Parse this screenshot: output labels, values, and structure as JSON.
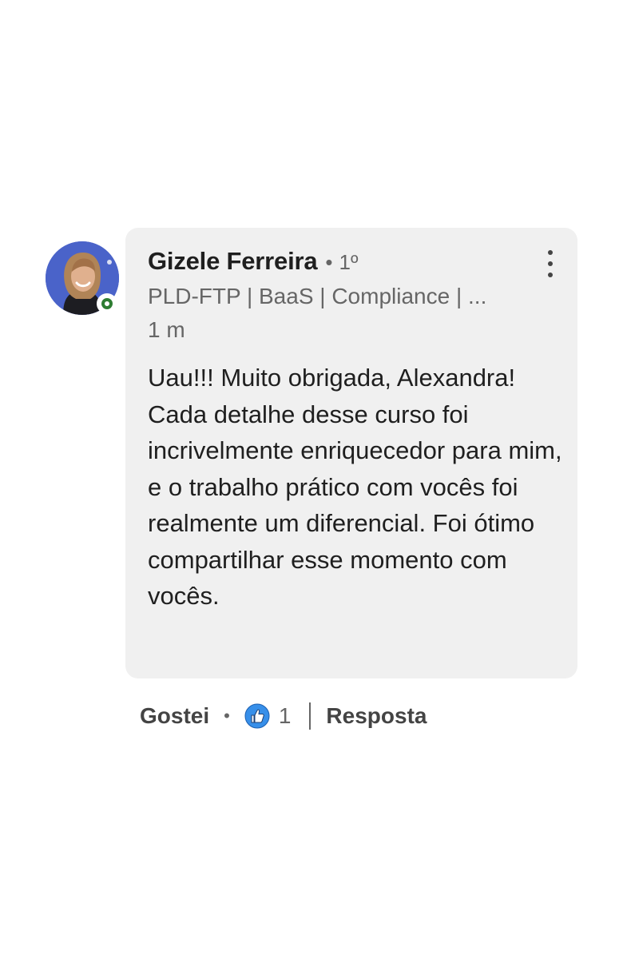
{
  "comment": {
    "author": {
      "name": "Gizele Ferreira",
      "degree": "1º",
      "headline": "PLD-FTP | BaaS | Compliance | ...",
      "avatar_icon": "profile-photo",
      "presence": "online",
      "presence_color": "#2e7d32"
    },
    "timestamp": "1 m",
    "menu_icon": "more-vertical-icon",
    "text": "Uau!!! Muito obrigada, Alexandra! Cada detalhe desse curso foi incrivelmente enriquecedor para mim, e o trabalho prático com vocês foi realmente um diferencial. Foi ótimo compartilhar esse momento com vocês.",
    "bubble_color": "#f0f0f0"
  },
  "actions": {
    "like_label": "Gostei",
    "separator": "•",
    "reaction_icon": "like-reaction-icon",
    "reaction_count": "1",
    "reply_label": "Resposta"
  }
}
